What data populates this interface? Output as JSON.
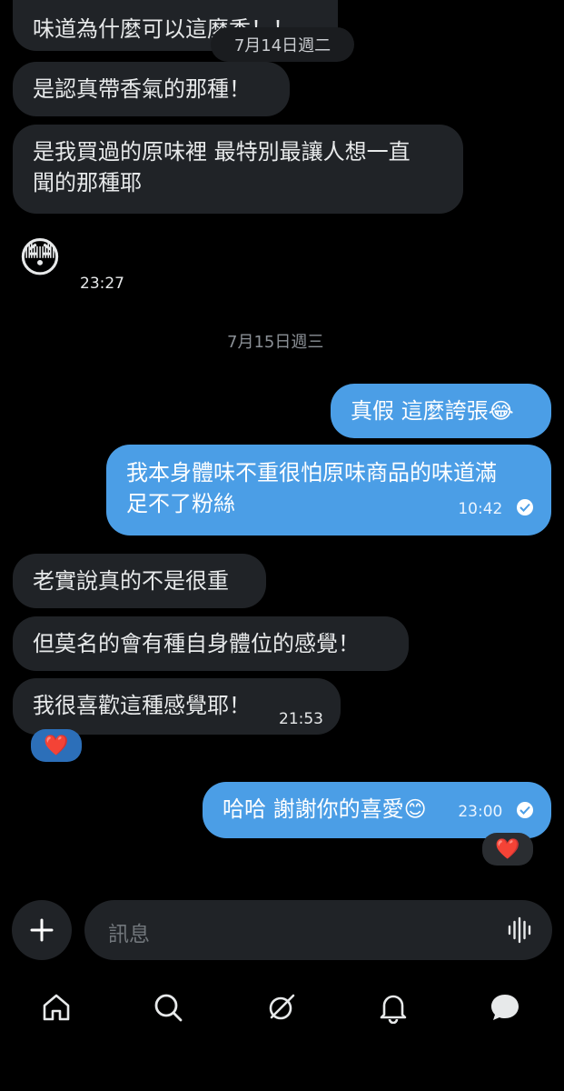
{
  "messages": {
    "m1": "味道為什麼可以這麼香！！",
    "date_jul14": "7月14日週二",
    "m2": "是認真帶香氣的那種！",
    "m3_line1": "是我買過的原味裡 最特別最讓人想一直",
    "m3_line2": "聞的那種耶",
    "m4_emoji": "😳",
    "m4_time": "23:27",
    "date_jul15": "7月15日週三",
    "out1": "真假 這麼誇張😂",
    "out2_line1": "我本身體味不重很怕原味商品的味道滿",
    "out2_line2": "足不了粉絲",
    "out2_time": "10:42",
    "m5": "老實說真的不是很重",
    "m6": "但莫名的會有種自身體位的感覺！",
    "m7": "我很喜歡這種感覺耶！",
    "m7_time": "21:53",
    "m7_reaction": "❤️",
    "out3": "哈哈 謝謝你的喜愛😊",
    "out3_time": "23:00",
    "out3_reaction": "❤️"
  },
  "composer": {
    "placeholder": "訊息"
  },
  "nav": {
    "items": [
      "home-icon",
      "search-icon",
      "grok-icon",
      "notifications-icon",
      "messages-icon"
    ]
  },
  "colors": {
    "outgoing": "#4b9ee6",
    "incoming": "#202327",
    "background": "#000000"
  }
}
